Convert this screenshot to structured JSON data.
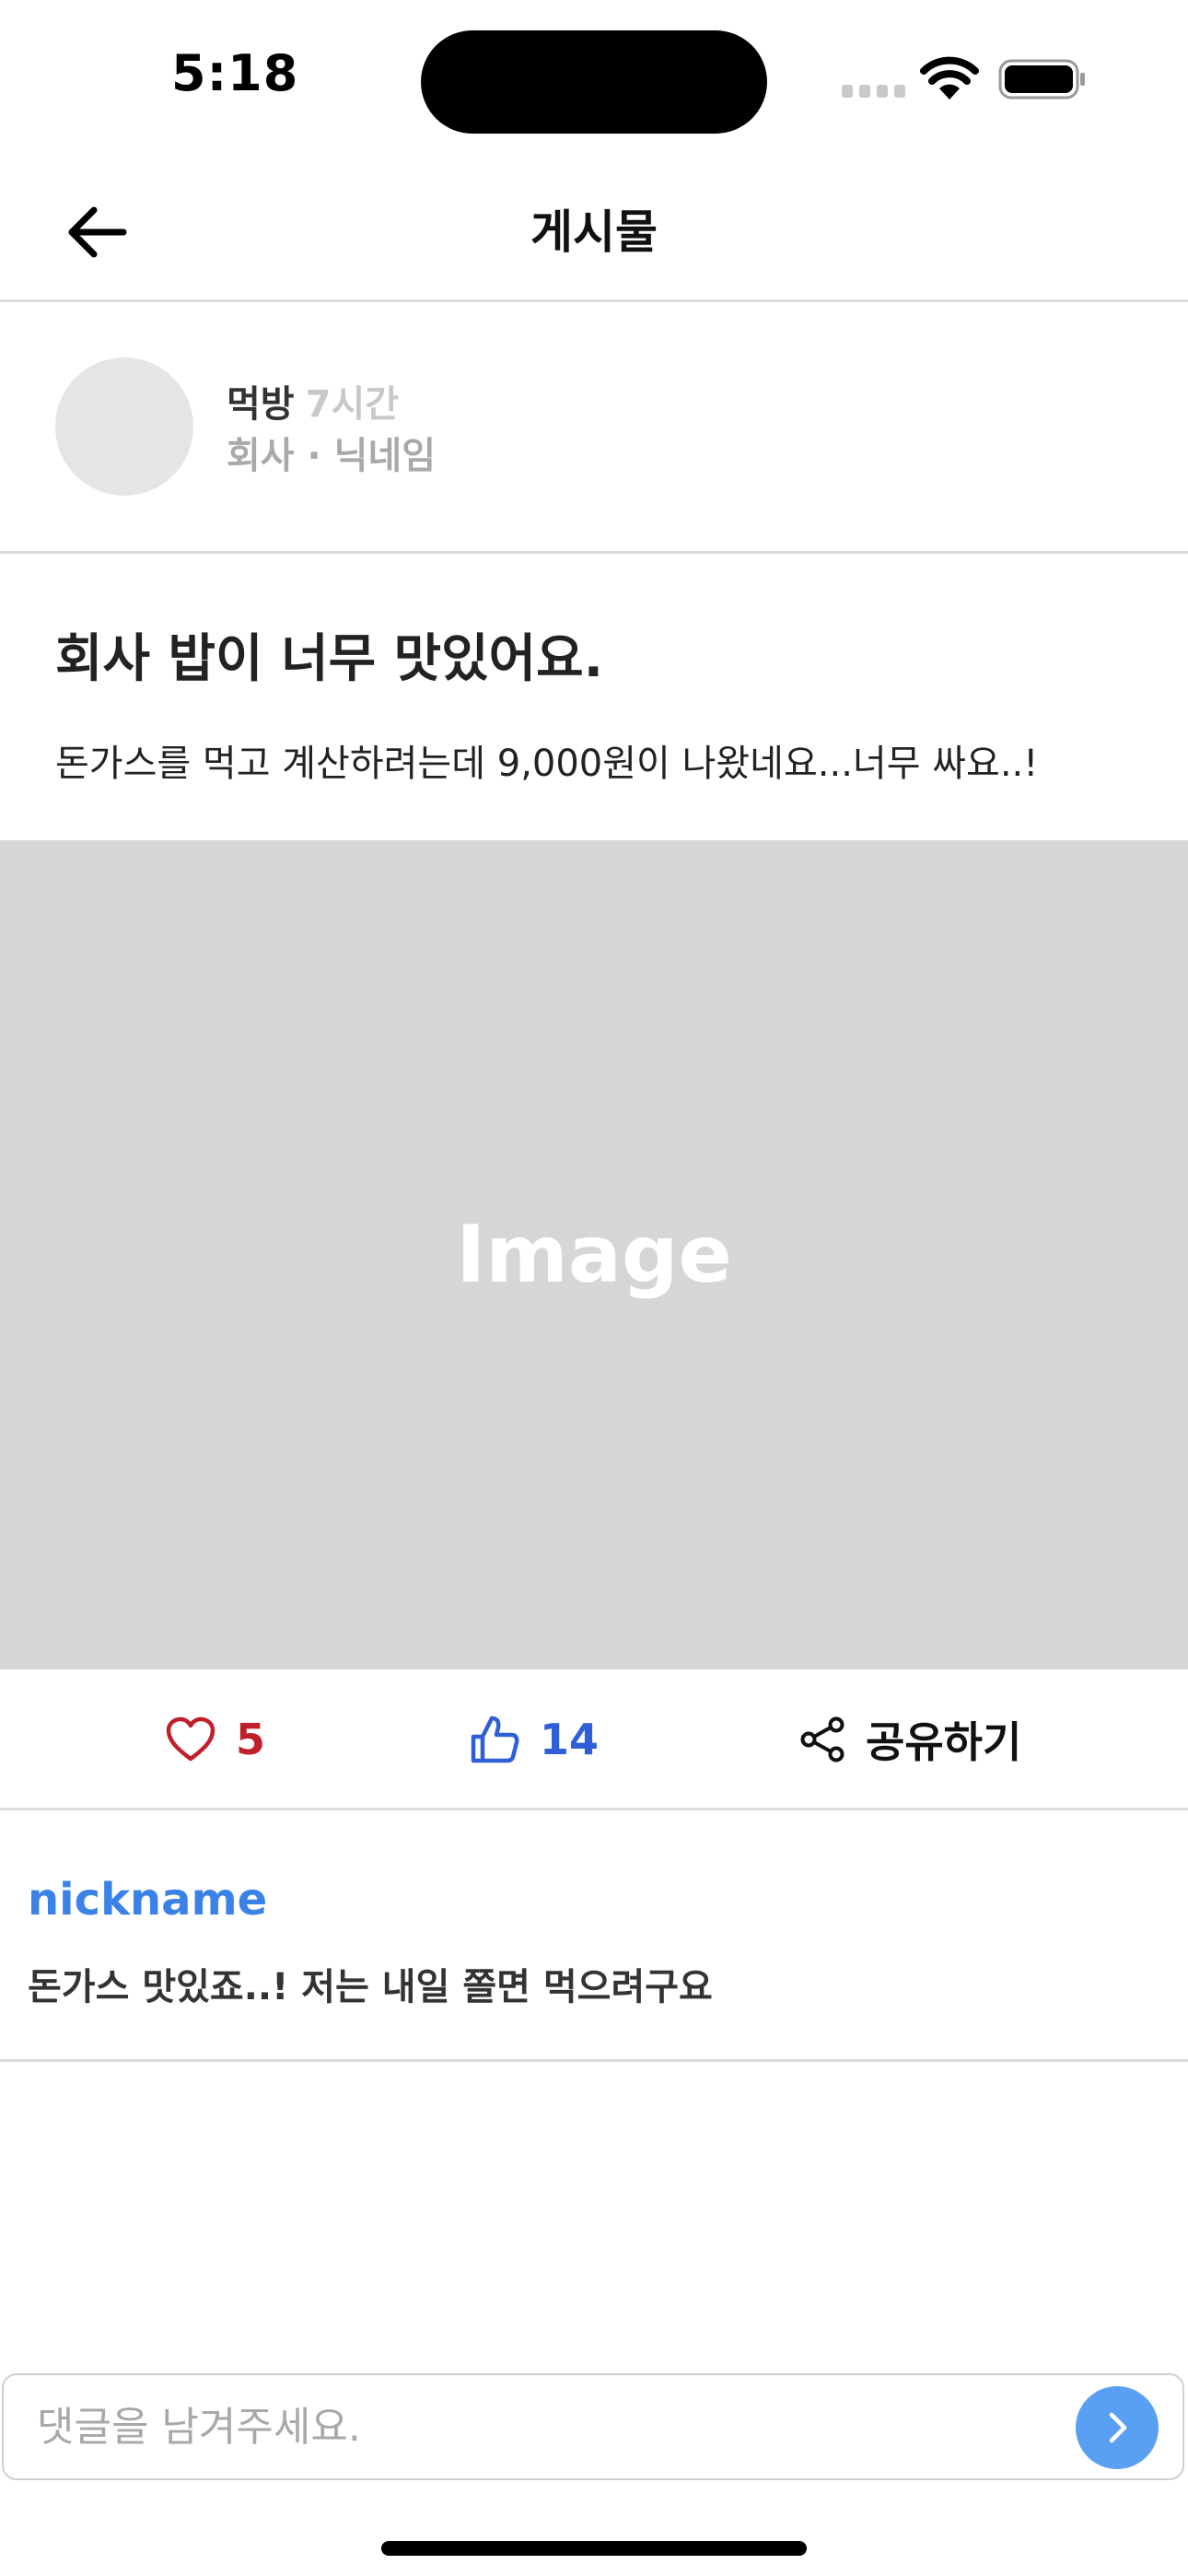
{
  "status_bar": {
    "time": "5:18"
  },
  "header": {
    "title": "게시물",
    "back_icon": "arrow-left-icon"
  },
  "author": {
    "category": "먹방",
    "time_ago": "7시간",
    "meta": "회사 · 닉네임"
  },
  "post": {
    "title": "회사 밥이 너무 맛있어요.",
    "body": "돈가스를 먹고 계산하려는데 9,000원이 나왔네요...너무 싸요..!",
    "image_label": "Image"
  },
  "actions": {
    "like_count": "5",
    "thumb_count": "14",
    "share_label": "공유하기",
    "colors": {
      "like": "#c0202a",
      "thumb": "#2e5fd6",
      "accent": "#5aa0f2",
      "nickname": "#3b82e6"
    }
  },
  "comments": [
    {
      "nickname": "nickname",
      "text": "돈가스 맛있죠..! 저는 내일 쫄면 먹으려구요"
    }
  ],
  "comment_input": {
    "placeholder": "댓글을 남겨주세요.",
    "value": ""
  }
}
